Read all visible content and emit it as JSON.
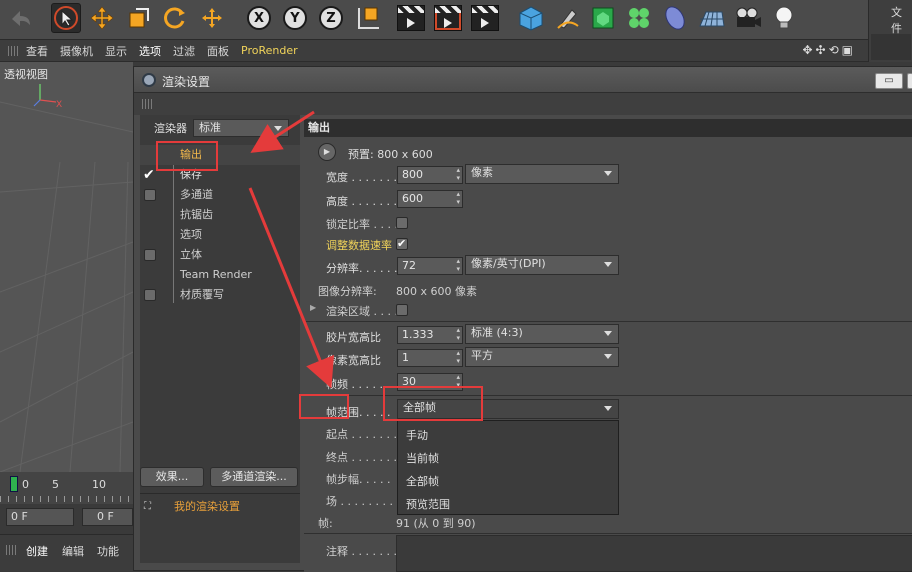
{
  "toolbar": {
    "axis_x": "X",
    "axis_y": "Y",
    "axis_z": "Z"
  },
  "menubar": {
    "items": [
      "查看",
      "摄像机",
      "显示",
      "选项",
      "过滤",
      "面板",
      "ProRender"
    ]
  },
  "right_strip": {
    "label": "文件"
  },
  "viewport": {
    "label": "透视视图"
  },
  "timeline": {
    "ticks": [
      "0",
      "5",
      "10"
    ],
    "frame_start": "0 F",
    "frame_current": "0 F",
    "bottom_menu": [
      "创建",
      "编辑",
      "功能"
    ]
  },
  "dialog": {
    "title": "渲染设置",
    "left": {
      "renderer_label": "渲染器",
      "renderer_value": "标准",
      "items": [
        {
          "label": "输出",
          "checked": false
        },
        {
          "label": "保存",
          "checked": true
        },
        {
          "label": "多通道",
          "checked": false
        },
        {
          "label": "抗锯齿",
          "checked": false
        },
        {
          "label": "选项",
          "checked": false
        },
        {
          "label": "立体",
          "checked": false
        },
        {
          "label": "Team Render",
          "checked": false
        },
        {
          "label": "材质覆写",
          "checked": false
        }
      ],
      "effects_button": "效果...",
      "multipass_button": "多通道渲染...",
      "my_settings": "我的渲染设置"
    },
    "output": {
      "section_title": "输出",
      "preset": "预置: 800 x 600",
      "width_label": "宽度 . . . . . . .",
      "width_value": "800",
      "width_unit": "像素",
      "height_label": "高度 . . . . . . .",
      "height_value": "600",
      "lock_ratio_label": "锁定比率 . . . .",
      "adjust_rate_label": "调整数据速率",
      "resolution_label": "分辨率. . . . . .",
      "resolution_value": "72",
      "resolution_unit": "像素/英寸(DPI)",
      "image_res_label": "图像分辨率:",
      "image_res_value": "800 x 600 像素",
      "render_region_label": "渲染区域 . . . .",
      "film_aspect_label": "胶片宽高比",
      "film_aspect_value": "1.333",
      "film_aspect_preset": "标准 (4:3)",
      "pixel_aspect_label": "像素宽高比",
      "pixel_aspect_value": "1",
      "pixel_aspect_preset": "平方",
      "fps_label": "帧频 . . . . . . .",
      "fps_value": "30",
      "frame_range_label": "帧范围. . . . .",
      "frame_range_value": "全部帧",
      "start_label": "起点 . . . . . . .",
      "end_label": "终点 . . . . . . .",
      "step_label": "帧步幅. . . . .",
      "field_label": "场 . . . . . . . . .",
      "frames_label": "帧:",
      "frames_value": "91 (从 0 到 90)",
      "notes_label": "注释 . . . . . . ."
    },
    "frame_range_menu": [
      "手动",
      "当前帧",
      "全部帧",
      "预览范围"
    ]
  },
  "colors": {
    "accent_yellow": "#f0d35a",
    "active_orange": "#f2b84b",
    "annotation_red": "#e43b3b"
  }
}
